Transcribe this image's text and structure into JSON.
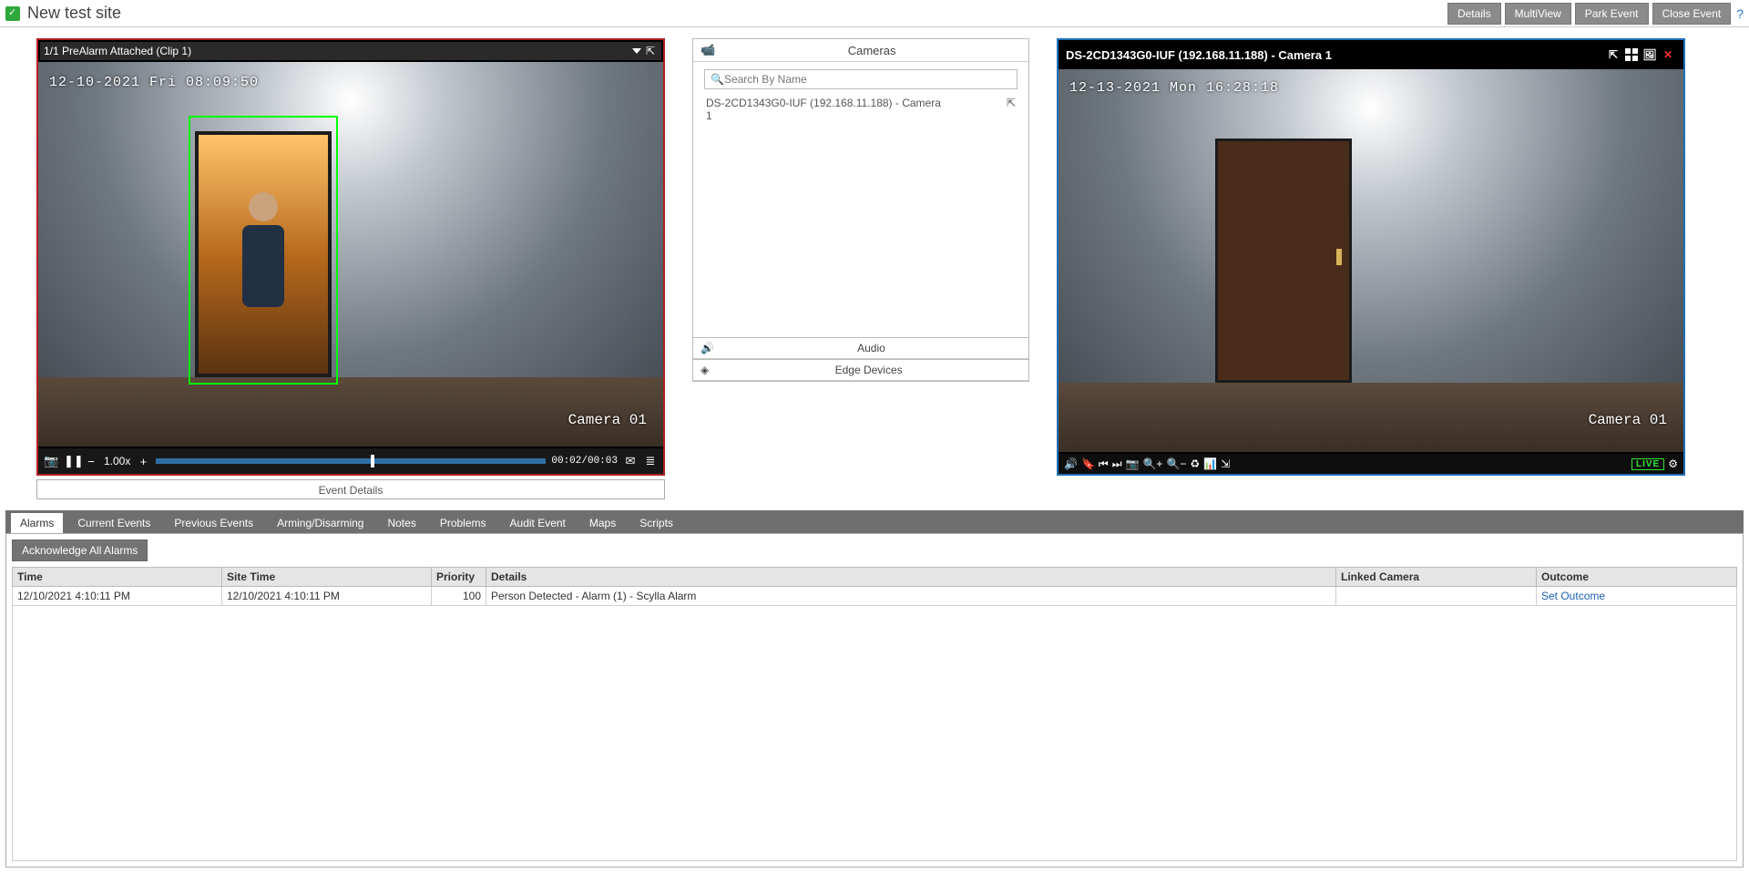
{
  "header": {
    "site_title": "New test site",
    "buttons": {
      "details": "Details",
      "multiview": "MultiView",
      "park": "Park Event",
      "close": "Close Event"
    }
  },
  "left": {
    "titlebar": "1/1 PreAlarm Attached (Clip 1)",
    "osd_time": "12-10-2021 Fri 08:09:50",
    "osd_cam": "Camera 01",
    "speed": "1.00x",
    "time_readout": "00:02/00:03",
    "event_details": "Event Details"
  },
  "mid": {
    "cameras_head": "Cameras",
    "search_placeholder": "Search By Name",
    "camera_item": "DS-2CD1343G0-IUF (192.168.11.188) - Camera 1",
    "audio_head": "Audio",
    "edge_head": "Edge Devices"
  },
  "right": {
    "titlebar": "DS-2CD1343G0-IUF (192.168.11.188) - Camera 1",
    "osd_time": "12-13-2021 Mon 16:28:18",
    "osd_cam": "Camera 01",
    "live": "LIVE"
  },
  "tabs": {
    "alarms": "Alarms",
    "current": "Current Events",
    "previous": "Previous Events",
    "arming": "Arming/Disarming",
    "notes": "Notes",
    "problems": "Problems",
    "audit": "Audit Event",
    "maps": "Maps",
    "scripts": "Scripts"
  },
  "alarms": {
    "ack_all": "Acknowledge All Alarms",
    "cols": {
      "time": "Time",
      "site_time": "Site Time",
      "priority": "Priority",
      "details": "Details",
      "linked": "Linked Camera",
      "outcome": "Outcome"
    },
    "row": {
      "time": "12/10/2021 4:10:11 PM",
      "site_time": "12/10/2021 4:10:11 PM",
      "priority": "100",
      "details": "Person Detected - Alarm (1) - Scylla Alarm",
      "linked": "",
      "outcome": "Set Outcome"
    }
  }
}
